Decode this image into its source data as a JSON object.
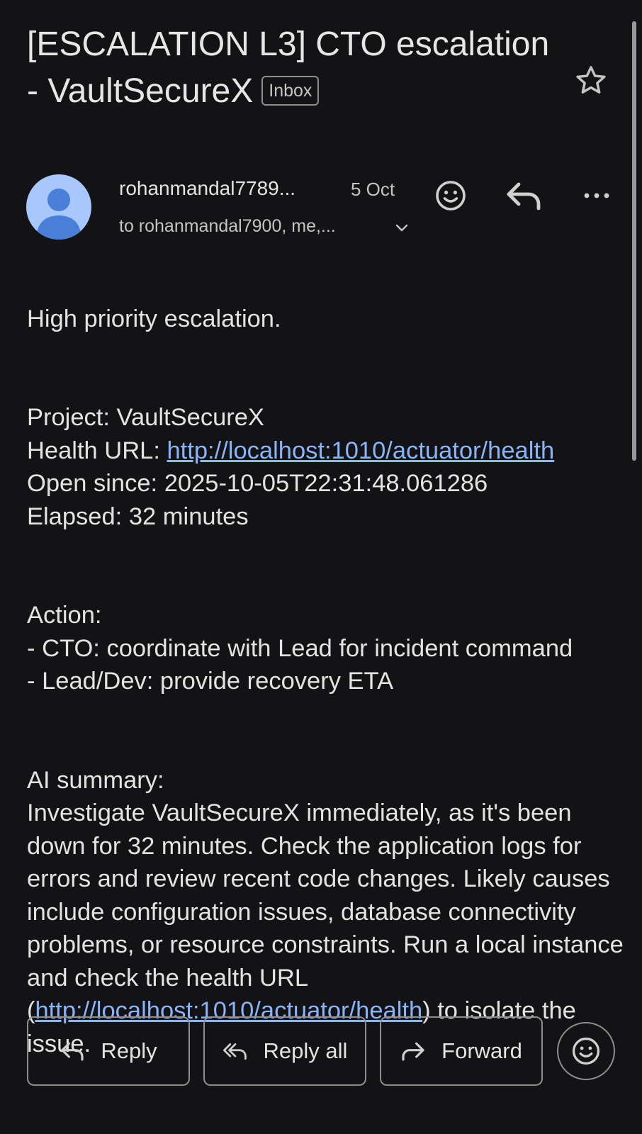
{
  "email": {
    "subject": "[ESCALATION L3] CTO escalation - VaultSecureX",
    "label": "Inbox",
    "sender": "rohanmandal7789...",
    "date": "5 Oct",
    "recipients": "to rohanmandal7900, me,..."
  },
  "body": {
    "intro": "High priority escalation.",
    "project_line": "Project: VaultSecureX",
    "health_label": "Health URL: ",
    "health_url": "http://localhost:1010/actuator/health",
    "open_since_line": "Open since: 2025-10-05T22:31:48.061286",
    "elapsed_line": "Elapsed: 32 minutes",
    "action_heading": "Action:",
    "action_item_1": "- CTO: coordinate with Lead for incident command",
    "action_item_2": "- Lead/Dev: provide recovery ETA",
    "summary_heading": "AI summary:",
    "summary_text": "Investigate VaultSecureX immediately, as it's been down for 32 minutes. Check the application logs for errors and review recent code changes. Likely causes include configuration issues, database connectivity problems, or resource constraints. Run a local instance and check the health URL (",
    "summary_url": "http://localhost:1010/actuator/health",
    "summary_tail": ") to isolate the issue."
  },
  "actions": {
    "reply_label": "Reply",
    "reply_all_label": "Reply all",
    "forward_label": "Forward"
  },
  "icons": {
    "star": "star-outline-icon",
    "avatar": "person-avatar-icon",
    "emoji": "emoji-smile-icon",
    "reply": "reply-arrow-icon",
    "more": "more-horizontal-icon",
    "reply_all": "reply-all-icon",
    "forward": "forward-arrow-icon",
    "expand": "chevron-down-icon"
  },
  "colors": {
    "background": "#131316",
    "text": "#e3e3e3",
    "link": "#8ab4f8",
    "avatar_bg": "#a8c7fa",
    "avatar_fg": "#4a7fd9"
  }
}
